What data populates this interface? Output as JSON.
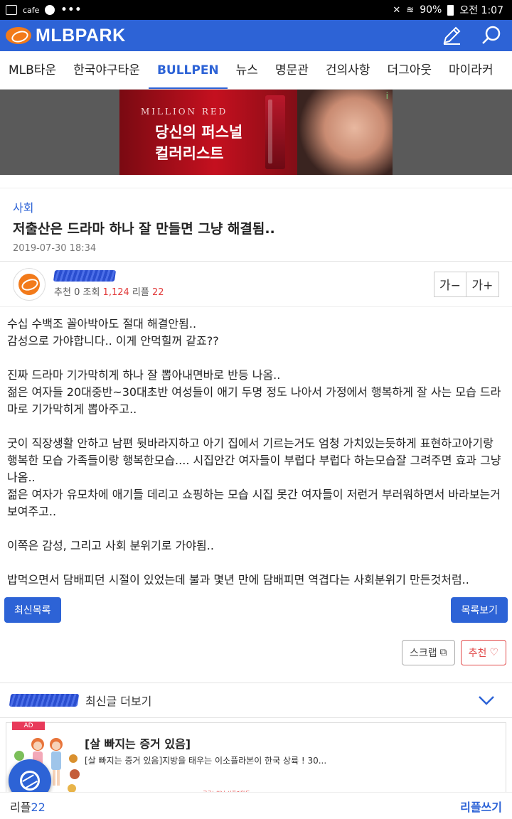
{
  "status_bar": {
    "app": "cafe",
    "dots": "•••",
    "battery": "90%",
    "time": "오전 1:07"
  },
  "header": {
    "brand": "MLBPARK",
    "icons": [
      "pencil-icon",
      "search-icon"
    ],
    "accent": "#2d63d6"
  },
  "tabs": [
    {
      "label": "MLB타운"
    },
    {
      "label": "한국야구타운"
    },
    {
      "label": "BULLPEN",
      "active": true
    },
    {
      "label": "뉴스"
    },
    {
      "label": "명문관"
    },
    {
      "label": "건의사항"
    },
    {
      "label": "더그아웃"
    },
    {
      "label": "마이라커"
    }
  ],
  "banner": {
    "small": "MILLION RED",
    "line1": "당신의 퍼스널",
    "line2": "컬러리스트",
    "info": "i"
  },
  "article": {
    "category": "사회",
    "title": "저출산은 드라마 하나 잘 만들면 그냥 해결됨..",
    "date": "2019-07-30 18:34",
    "stats": {
      "rec_label": "추천",
      "rec": "0",
      "views_label": "조회",
      "views": "1,124",
      "replies_label": "리플",
      "replies": "22"
    },
    "font_smaller": "가−",
    "font_larger": "가+",
    "body": [
      "수십 수백조 꼴아박아도 절대 해결안됨..",
      "감성으로 가야합니다..  이게 안먹힐꺼 같죠??",
      "",
      "진짜 드라마 기가막히게 하나 잘 뽑아내면바로 반등 나옴..",
      "젊은 여자들 20대중반~30대초반 여성들이 애기 두명 정도 나아서 가정에서 행복하게 잘 사는 모습  드라마로 기가막히게 뽑아주고..",
      "",
      "굿이 직장생활 안하고 남편 뒷바라지하고 아기 집에서 기르는거도 엄청 가치있는듯하게 표현하고아기랑 행복한 모습 가족들이랑 행복한모습.... 시집안간 여자들이 부럽다 부럽다 하는모습잘 그려주면 효과 그냥 나옴..",
      "젊은 여자가 유모차에 애기들 데리고 쇼핑하는 모습 시집 못간 여자들이 저런거 부러워하면서 바라보는거 보여주고..",
      "",
      "이쪽은 감성, 그리고 사회 분위기로 가야됨..",
      "",
      "밥먹으면서 담배피던 시절이 있었는데 불과 몇년 만에  담배피면 역겹다는 사회분위기 만든것처럼.."
    ]
  },
  "buttons": {
    "latest_list": "최신목록",
    "view_list": "목록보기",
    "scrap": "스크랩",
    "recommend": "추천"
  },
  "latest_more": "최신글 더보기",
  "ad": {
    "tag": "AD",
    "title": "[살 빠지는 증거 있음]",
    "desc": "[살 빠지는 증거 있음]지방을 태우는 이소플라본이 한국 상륙 ! 30...",
    "brand": "쿠쿠노하나 서플리먼트"
  },
  "footer": {
    "replies_label": "리플",
    "replies_count": "22",
    "write_reply": "리플쓰기"
  }
}
